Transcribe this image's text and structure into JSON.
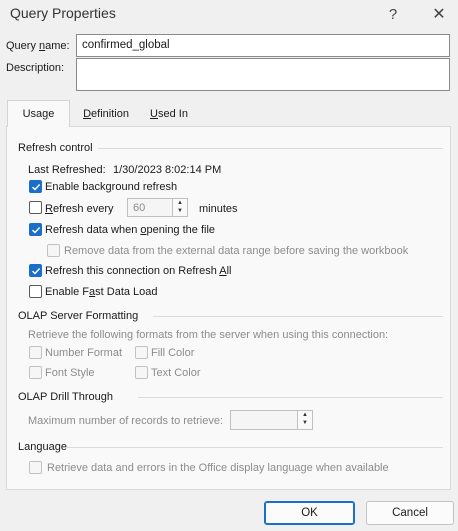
{
  "window": {
    "title": "Query Properties",
    "help_glyph": "?",
    "close_glyph": "✕"
  },
  "form": {
    "query_name": {
      "label_pre": "Query ",
      "label_ul": "n",
      "label_post": "ame:",
      "value": "confirmed_global"
    },
    "description": {
      "label": "Description:",
      "value": ""
    }
  },
  "tabs": [
    {
      "pre": "Usa",
      "ul": "g",
      "post": "e",
      "active": true
    },
    {
      "pre": "",
      "ul": "D",
      "post": "efinition",
      "active": false
    },
    {
      "pre": "",
      "ul": "U",
      "post": "sed In",
      "active": false
    }
  ],
  "refresh_control": {
    "title": "Refresh control",
    "last_refreshed_label": "Last Refreshed:",
    "last_refreshed_value": "1/30/2023  8:02:14 PM",
    "enable_background": {
      "pre": "Enable back",
      "ul": "g",
      "post": "round refresh",
      "checked": true
    },
    "refresh_every": {
      "pre": "",
      "ul": "R",
      "post": "efresh every",
      "checked": false,
      "value": "60",
      "unit": "minutes"
    },
    "refresh_on_open": {
      "pre": "Refresh data when ",
      "ul": "o",
      "post": "pening the file",
      "checked": true
    },
    "remove_data": {
      "label": "Remove data from the external data range before saving the workbook",
      "checked": false
    },
    "refresh_all": {
      "pre": "Refresh this connection on Refresh ",
      "ul": "A",
      "post": "ll",
      "checked": true
    },
    "fast_load": {
      "pre": "Enable F",
      "ul": "a",
      "post": "st Data Load",
      "checked": false
    }
  },
  "olap_formatting": {
    "title": "OLAP Server Formatting",
    "description": "Retrieve the following formats from the server when using this connection:",
    "number_format": "Number Format",
    "fill_color": "Fill Color",
    "font_style": "Font Style",
    "text_color": "Text Color"
  },
  "olap_drill": {
    "title": "OLAP Drill Through",
    "max_records_label": "Maximum number of records to retrieve:",
    "max_records_value": ""
  },
  "language": {
    "title": "Language",
    "office_language": "Retrieve data and errors in the Office display language when available"
  },
  "footer": {
    "ok": "OK",
    "cancel": "Cancel"
  },
  "colors": {
    "accent": "#1a6fc9",
    "dialog_bg": "#f0f0f0",
    "panel_bg": "#f9f9f9"
  }
}
